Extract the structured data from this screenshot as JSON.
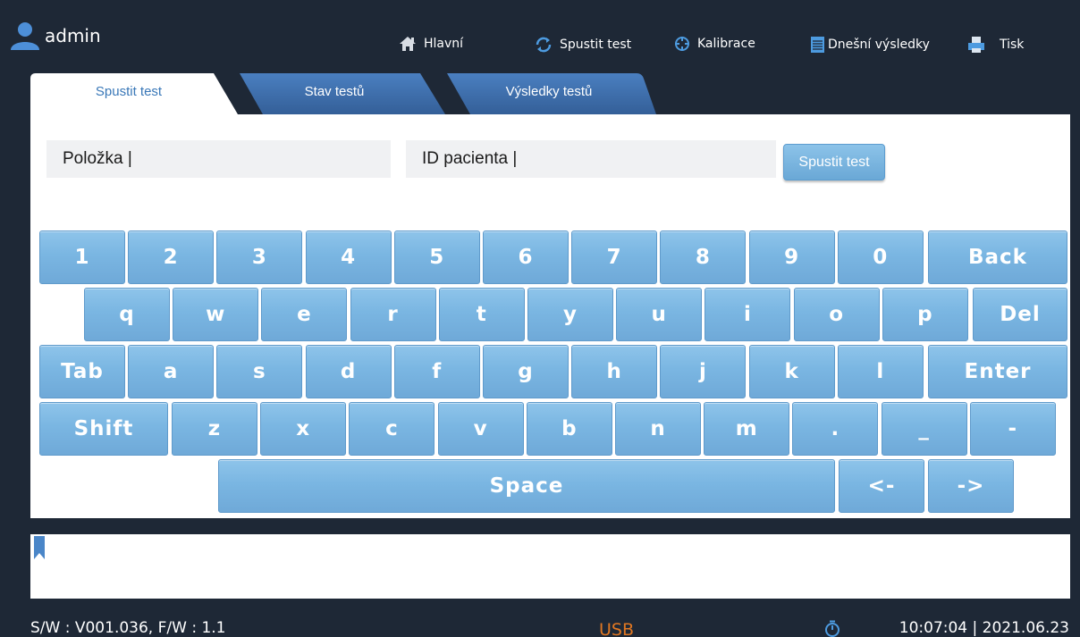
{
  "user": {
    "name": "admin",
    "icon": "user-icon"
  },
  "nav": {
    "home": {
      "label": "Hlavní",
      "icon": "home-icon"
    },
    "run": {
      "label": "Spustit test",
      "icon": "refresh-icon"
    },
    "calibration": {
      "label": "Kalibrace",
      "icon": "crosshair-icon"
    },
    "today": {
      "label": "Dnešní výsledky",
      "icon": "notepad-icon"
    },
    "print": {
      "label": "Tisk",
      "icon": "printer-icon"
    }
  },
  "tabs": [
    {
      "label": "Spustit test",
      "active": true
    },
    {
      "label": "Stav testů",
      "active": false
    },
    {
      "label": "Výsledky testů",
      "active": false
    }
  ],
  "form": {
    "item_field": "Položka |",
    "patient_field": "ID pacienta |",
    "run_button": "Spustit test"
  },
  "keyboard": {
    "rows": [
      [
        "1",
        "2",
        "3",
        "4",
        "5",
        "6",
        "7",
        "8",
        "9",
        "0",
        "Back"
      ],
      [
        "q",
        "w",
        "e",
        "r",
        "t",
        "y",
        "u",
        "i",
        "o",
        "p",
        "Del"
      ],
      [
        "Tab",
        "a",
        "s",
        "d",
        "f",
        "g",
        "h",
        "j",
        "k",
        "l",
        "Enter"
      ],
      [
        "Shift",
        "z",
        "x",
        "c",
        "v",
        "b",
        "n",
        "m",
        ".",
        "_",
        "-"
      ],
      [
        "Space",
        "<-",
        "->"
      ]
    ]
  },
  "status": {
    "software": "S/W : V001.036, F/W : 1.1",
    "usb": "USB",
    "datetime": "10:07:04 | 2021.06.23",
    "timer_icon": "stopwatch-icon"
  },
  "colors": {
    "background": "#1e2836",
    "tab_inactive": "#3f6eae",
    "key": "#7ab6e2",
    "usb": "#e07722"
  }
}
